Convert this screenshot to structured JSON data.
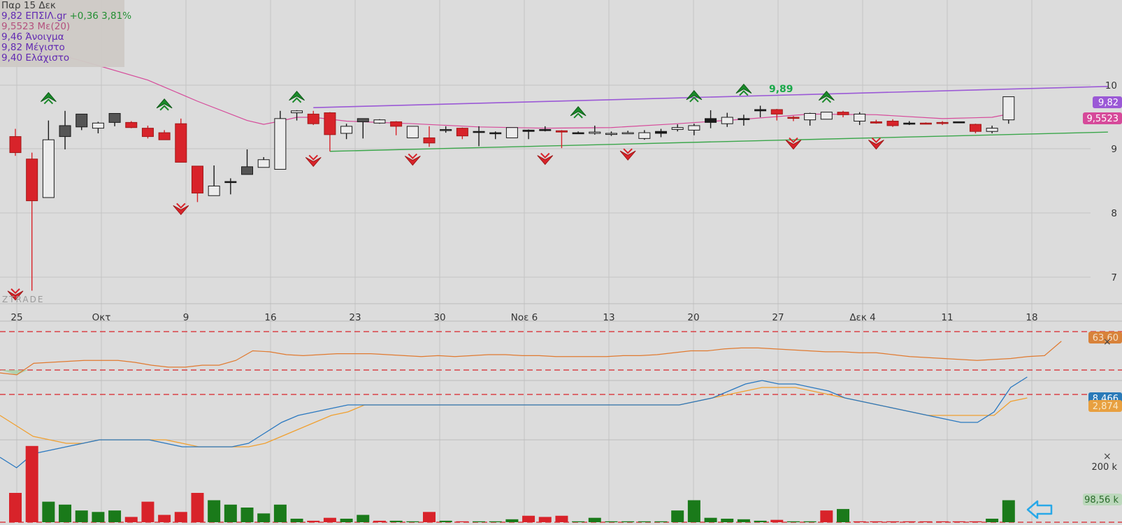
{
  "legend": {
    "date": "Παρ 15 Δεκ",
    "price_line": "9,82 ΕΠΣΙΛ.gr",
    "change": "+0,36 3,81%",
    "ma_line": "9,5523 Με(20)",
    "open_line": "9,46 Άνοιγμα",
    "high_line": "9,82 Μέγιστο",
    "low_line": "9,40 Ελάχιστο"
  },
  "watermark": "ZTRADE",
  "callout_high": "9,89",
  "badges": {
    "price": "9,82",
    "ma": "9,5523",
    "rsi": "63,60",
    "macd": "8,466",
    "signal": "2,874",
    "volume": "98,56 k",
    "volume_axis": "200 k"
  },
  "colors": {
    "background": "#dcdcdc",
    "up": "#1a7a1a",
    "down": "#d8232a",
    "purple_line": "#9b59d6",
    "green_line": "#3aa64a",
    "ma_line": "#d64a9a",
    "rsi": "#e07a30",
    "macd": "#2a78c0",
    "signal": "#f0a030",
    "arrow": "#28a8e8"
  },
  "chart_data": {
    "type": "candlestick",
    "x_tick_labels": [
      "25",
      "Οκτ",
      "9",
      "16",
      "23",
      "30",
      "Νοε 6",
      "13",
      "20",
      "27",
      "Δεκ 4",
      "11",
      "18"
    ],
    "y_tick_labels": [
      "10",
      "9",
      "8",
      "7"
    ],
    "ylim": [
      6.75,
      10.25
    ],
    "candles": [
      [
        9.2,
        9.32,
        8.9,
        8.95,
        "d"
      ],
      [
        8.85,
        8.95,
        6.8,
        8.2,
        "d"
      ],
      [
        8.25,
        9.45,
        8.25,
        9.15,
        "h"
      ],
      [
        9.2,
        9.6,
        9.0,
        9.37,
        "u"
      ],
      [
        9.35,
        9.55,
        9.3,
        9.55,
        "u"
      ],
      [
        9.33,
        9.43,
        9.25,
        9.41,
        "h"
      ],
      [
        9.42,
        9.56,
        9.36,
        9.56,
        "u"
      ],
      [
        9.42,
        9.44,
        9.33,
        9.34,
        "d"
      ],
      [
        9.33,
        9.37,
        9.17,
        9.2,
        "d"
      ],
      [
        9.26,
        9.3,
        9.15,
        9.15,
        "d"
      ],
      [
        9.4,
        9.48,
        8.8,
        8.8,
        "d"
      ],
      [
        8.74,
        8.74,
        8.18,
        8.32,
        "d"
      ],
      [
        8.28,
        8.75,
        8.28,
        8.43,
        "h"
      ],
      [
        8.5,
        8.55,
        8.3,
        8.5,
        "x"
      ],
      [
        8.61,
        9.0,
        8.61,
        8.73,
        "u"
      ],
      [
        8.72,
        8.88,
        8.72,
        8.84,
        "h"
      ],
      [
        8.69,
        9.6,
        8.69,
        9.48,
        "h"
      ],
      [
        9.6,
        9.61,
        9.45,
        9.57,
        "h"
      ],
      [
        9.55,
        9.6,
        9.38,
        9.4,
        "d"
      ],
      [
        9.57,
        9.58,
        8.97,
        9.23,
        "d"
      ],
      [
        9.25,
        9.4,
        9.16,
        9.36,
        "h"
      ],
      [
        9.48,
        9.48,
        9.17,
        9.43,
        "u"
      ],
      [
        9.46,
        9.47,
        9.4,
        9.41,
        "h"
      ],
      [
        9.43,
        9.44,
        9.22,
        9.36,
        "d"
      ],
      [
        9.36,
        9.36,
        9.18,
        9.18,
        "h"
      ],
      [
        9.18,
        9.36,
        9.04,
        9.1,
        "d"
      ],
      [
        9.31,
        9.36,
        9.26,
        9.31,
        "u"
      ],
      [
        9.33,
        9.34,
        9.16,
        9.21,
        "d"
      ],
      [
        9.28,
        9.36,
        9.05,
        9.28,
        "x"
      ],
      [
        9.26,
        9.28,
        9.16,
        9.26,
        "x"
      ],
      [
        9.18,
        9.34,
        9.18,
        9.34,
        "h"
      ],
      [
        9.28,
        9.31,
        9.16,
        9.3,
        "x"
      ],
      [
        9.31,
        9.36,
        9.28,
        9.31,
        "x"
      ],
      [
        9.29,
        9.3,
        9.02,
        9.27,
        "d"
      ],
      [
        9.25,
        9.28,
        9.24,
        9.26,
        "x"
      ],
      [
        9.25,
        9.37,
        9.23,
        9.27,
        "h"
      ],
      [
        9.24,
        9.28,
        9.21,
        9.25,
        "h"
      ],
      [
        9.26,
        9.29,
        9.24,
        9.25,
        "h"
      ],
      [
        9.17,
        9.3,
        9.15,
        9.26,
        "h"
      ],
      [
        9.25,
        9.32,
        9.19,
        9.28,
        "x"
      ],
      [
        9.31,
        9.39,
        9.28,
        9.34,
        "h"
      ],
      [
        9.3,
        9.4,
        9.22,
        9.37,
        "h"
      ],
      [
        9.42,
        9.61,
        9.33,
        9.48,
        "x"
      ],
      [
        9.4,
        9.57,
        9.35,
        9.5,
        "h"
      ],
      [
        9.48,
        9.54,
        9.37,
        9.48,
        "x"
      ],
      [
        9.62,
        9.68,
        9.5,
        9.6,
        "x"
      ],
      [
        9.62,
        9.63,
        9.45,
        9.55,
        "d"
      ],
      [
        9.5,
        9.52,
        9.44,
        9.49,
        "d"
      ],
      [
        9.46,
        9.57,
        9.37,
        9.56,
        "h"
      ],
      [
        9.47,
        9.58,
        9.47,
        9.58,
        "h"
      ],
      [
        9.58,
        9.6,
        9.5,
        9.54,
        "d"
      ],
      [
        9.44,
        9.58,
        9.38,
        9.55,
        "h"
      ],
      [
        9.43,
        9.46,
        9.4,
        9.41,
        "d"
      ],
      [
        9.44,
        9.47,
        9.35,
        9.37,
        "d"
      ],
      [
        9.41,
        9.44,
        9.38,
        9.4,
        "x"
      ],
      [
        9.41,
        9.42,
        9.4,
        9.41,
        "d"
      ],
      [
        9.42,
        9.44,
        9.38,
        9.41,
        "d"
      ],
      [
        9.42,
        9.43,
        9.42,
        9.43,
        "x"
      ],
      [
        9.39,
        9.4,
        9.25,
        9.28,
        "d"
      ],
      [
        9.28,
        9.37,
        9.25,
        9.33,
        "h"
      ],
      [
        9.46,
        9.82,
        9.4,
        9.82,
        "h"
      ]
    ],
    "ma20": [
      [
        0,
        10.65
      ],
      [
        4,
        10.38
      ],
      [
        8,
        10.08
      ],
      [
        11,
        9.75
      ],
      [
        14,
        9.45
      ],
      [
        15,
        9.39
      ],
      [
        16,
        9.44
      ],
      [
        17,
        9.5
      ],
      [
        18,
        9.5
      ],
      [
        20,
        9.44
      ],
      [
        24,
        9.4
      ],
      [
        28,
        9.35
      ],
      [
        32,
        9.33
      ],
      [
        36,
        9.34
      ],
      [
        40,
        9.4
      ],
      [
        44,
        9.47
      ],
      [
        48,
        9.55
      ],
      [
        52,
        9.54
      ],
      [
        56,
        9.48
      ],
      [
        59,
        9.5
      ],
      [
        60,
        9.55
      ]
    ],
    "resistance_line": [
      [
        18,
        9.65
      ],
      [
        66,
        9.98
      ]
    ],
    "support_line": [
      [
        19,
        8.97
      ],
      [
        66,
        9.27
      ]
    ],
    "up_markers": [
      [
        2,
        9.82
      ],
      [
        9,
        9.72
      ],
      [
        17,
        9.84
      ],
      [
        34,
        9.6
      ],
      [
        41,
        9.85
      ],
      [
        44,
        9.95
      ],
      [
        49,
        9.84
      ]
    ],
    "down_markers": [
      [
        0,
        6.72
      ],
      [
        10,
        8.05
      ],
      [
        18,
        8.8
      ],
      [
        24,
        8.82
      ],
      [
        32,
        8.83
      ],
      [
        37,
        8.9
      ],
      [
        47,
        9.07
      ],
      [
        52,
        9.07
      ]
    ],
    "high_callout": [
      44,
      9.89
    ],
    "rsi_ylim": [
      0,
      100
    ],
    "rsi_levels": [
      70,
      30
    ],
    "rsi": [
      27,
      25,
      37,
      38,
      39,
      40,
      40,
      40,
      38,
      35,
      33,
      33,
      35,
      35,
      40,
      50,
      49,
      46,
      45,
      46,
      47,
      47,
      47,
      46,
      45,
      44,
      45,
      44,
      45,
      46,
      46,
      45,
      45,
      44,
      44,
      44,
      44,
      45,
      45,
      46,
      48,
      50,
      50,
      52,
      53,
      53,
      52,
      51,
      50,
      49,
      49,
      48,
      48,
      46,
      44,
      43,
      42,
      41,
      40,
      41,
      42,
      44,
      45,
      60
    ],
    "macd_ylim": [
      -20,
      20
    ],
    "macd_level": 3,
    "macd": [
      -15,
      -18,
      -14,
      -13,
      -12,
      -11,
      -10,
      -10,
      -10,
      -10,
      -11,
      -12,
      -12,
      -12,
      -12,
      -11,
      -8,
      -5,
      -3,
      -2,
      -1,
      0,
      0,
      0,
      0,
      0,
      0,
      0,
      0,
      0,
      0,
      0,
      0,
      0,
      0,
      0,
      0,
      0,
      0,
      0,
      0,
      0,
      1,
      2,
      4,
      6,
      7,
      6,
      6,
      5,
      4,
      2,
      1,
      0,
      -1,
      -2,
      -3,
      -4,
      -5,
      -5,
      -2,
      5,
      8
    ],
    "signal": [
      -3,
      -6,
      -9,
      -10,
      -11,
      -11,
      -10,
      -10,
      -10,
      -10,
      -10,
      -11,
      -12,
      -12,
      -12,
      -12,
      -11,
      -9,
      -7,
      -5,
      -3,
      -2,
      0,
      0,
      0,
      0,
      0,
      0,
      0,
      0,
      0,
      0,
      0,
      0,
      0,
      0,
      0,
      0,
      0,
      0,
      0,
      0,
      1,
      2,
      3,
      4,
      5,
      5,
      5,
      4,
      3,
      2,
      1,
      0,
      -1,
      -2,
      -3,
      -3,
      -3,
      -3,
      -3,
      1,
      2
    ],
    "volume_ylim": [
      0,
      280
    ],
    "volume": [
      [
        100,
        "d"
      ],
      [
        260,
        "d"
      ],
      [
        70,
        "u"
      ],
      [
        60,
        "u"
      ],
      [
        40,
        "u"
      ],
      [
        35,
        "u"
      ],
      [
        40,
        "u"
      ],
      [
        18,
        "d"
      ],
      [
        70,
        "d"
      ],
      [
        25,
        "d"
      ],
      [
        35,
        "d"
      ],
      [
        100,
        "d"
      ],
      [
        75,
        "u"
      ],
      [
        60,
        "u"
      ],
      [
        50,
        "u"
      ],
      [
        30,
        "u"
      ],
      [
        60,
        "u"
      ],
      [
        12,
        "u"
      ],
      [
        5,
        "d"
      ],
      [
        15,
        "d"
      ],
      [
        12,
        "u"
      ],
      [
        25,
        "u"
      ],
      [
        5,
        "d"
      ],
      [
        5,
        "u"
      ],
      [
        3,
        "u"
      ],
      [
        35,
        "d"
      ],
      [
        5,
        "u"
      ],
      [
        3,
        "d"
      ],
      [
        3,
        "u"
      ],
      [
        3,
        "u"
      ],
      [
        10,
        "u"
      ],
      [
        22,
        "d"
      ],
      [
        18,
        "d"
      ],
      [
        22,
        "d"
      ],
      [
        3,
        "u"
      ],
      [
        15,
        "u"
      ],
      [
        3,
        "u"
      ],
      [
        3,
        "u"
      ],
      [
        3,
        "u"
      ],
      [
        3,
        "u"
      ],
      [
        40,
        "u"
      ],
      [
        75,
        "u"
      ],
      [
        15,
        "u"
      ],
      [
        12,
        "u"
      ],
      [
        10,
        "u"
      ],
      [
        5,
        "u"
      ],
      [
        8,
        "d"
      ],
      [
        3,
        "u"
      ],
      [
        3,
        "u"
      ],
      [
        40,
        "d"
      ],
      [
        45,
        "u"
      ],
      [
        3,
        "d"
      ],
      [
        3,
        "d"
      ],
      [
        3,
        "d"
      ],
      [
        3,
        "d"
      ],
      [
        3,
        "d"
      ],
      [
        3,
        "d"
      ],
      [
        3,
        "d"
      ],
      [
        3,
        "d"
      ],
      [
        12,
        "u"
      ],
      [
        75,
        "u"
      ]
    ]
  }
}
